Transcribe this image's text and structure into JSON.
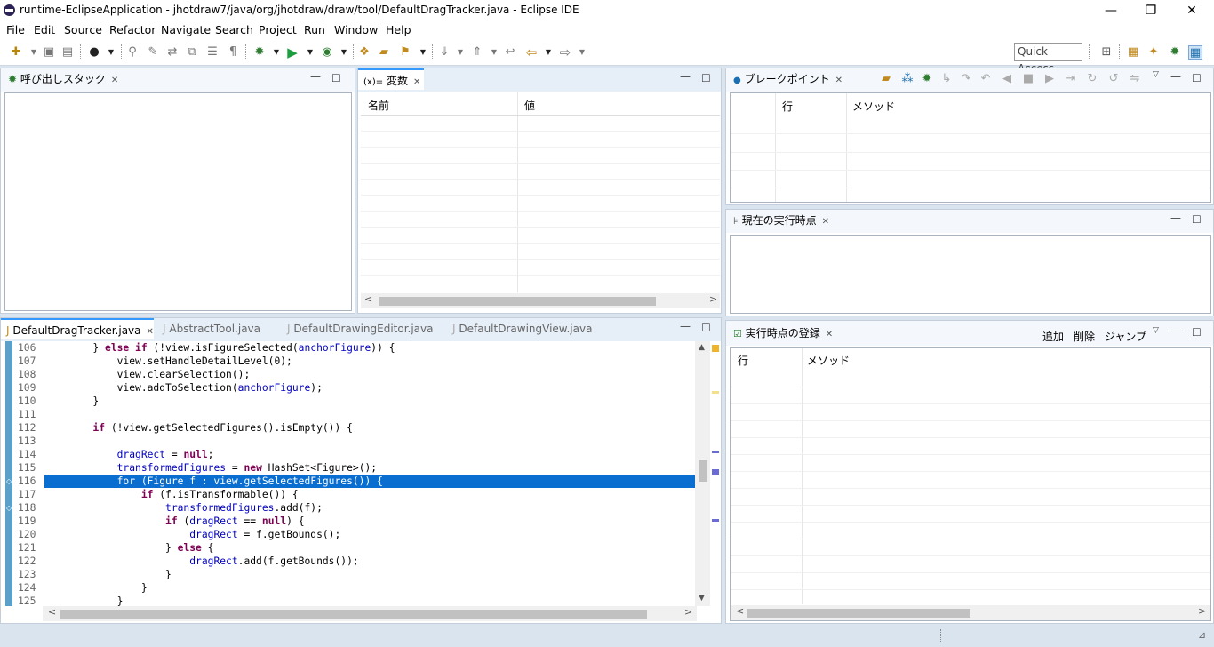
{
  "window": {
    "title": "runtime-EclipseApplication - jhotdraw7/java/org/jhotdraw/draw/tool/DefaultDragTracker.java - Eclipse IDE",
    "minimize": "—",
    "restore": "❐",
    "close": "✕"
  },
  "menu": [
    "File",
    "Edit",
    "Source",
    "Refactor",
    "Navigate",
    "Search",
    "Project",
    "Run",
    "Window",
    "Help"
  ],
  "toolbar": {
    "quick_access": "Quick Access"
  },
  "callstack": {
    "tab": "呼び出しスタック"
  },
  "variables": {
    "tab": "変数",
    "tab_prefix": "(x)=",
    "col_name": "名前",
    "col_value": "値"
  },
  "breakpoints": {
    "tab": "ブレークポイント",
    "col_line": "行",
    "col_method": "メソッド"
  },
  "current": {
    "tab": "現在の実行時点"
  },
  "registered": {
    "tab": "実行時点の登録",
    "add": "追加",
    "delete": "削除",
    "jump": "ジャンプ",
    "col_line": "行",
    "col_method": "メソッド"
  },
  "editor": {
    "tabs": [
      "DefaultDragTracker.java",
      "AbstractTool.java",
      "DefaultDrawingEditor.java",
      "DefaultDrawingView.java"
    ],
    "line_numbers": [
      "106",
      "107",
      "108",
      "109",
      "110",
      "111",
      "112",
      "113",
      "114",
      "115",
      "116",
      "117",
      "118",
      "119",
      "120",
      "121",
      "122",
      "123",
      "124",
      "125"
    ],
    "selected_line": "116"
  },
  "colors": {
    "selection": "#0a6ed1",
    "keyword": "#7f0055",
    "field": "#0000c0",
    "accent": "#3399ff"
  }
}
